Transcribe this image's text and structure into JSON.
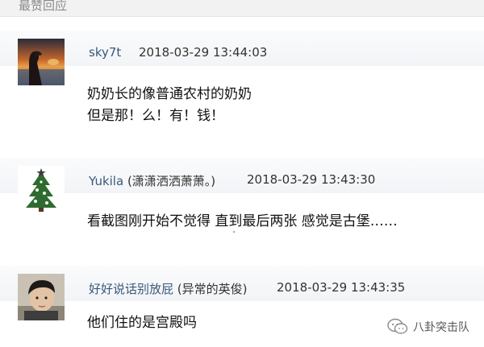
{
  "section": {
    "title": "最赞回应"
  },
  "comments": [
    {
      "username": "sky7t",
      "extra": "",
      "time": "2018-03-29 13:44:03",
      "lines": [
        "奶奶长的像普通农村的奶奶",
        "但是那！么！有！钱！"
      ],
      "avatar_icon": "sunset-photo-avatar"
    },
    {
      "username": "Yukila",
      "extra": "(潇潇洒洒萧萧。)",
      "time": "2018-03-29 13:43:30",
      "lines": [
        "看截图刚开始不觉得 直到最后两张 感觉是古堡……"
      ],
      "avatar_icon": "christmas-tree-avatar"
    },
    {
      "username": "好好说话别放屁",
      "extra": "(异常的英俊)",
      "time": "2018-03-29 13:43:35",
      "lines": [
        "他们住的是宫殿吗"
      ],
      "avatar_icon": "person-photo-avatar"
    }
  ],
  "watermark": {
    "text": "八卦突击队",
    "icon": "wechat-icon"
  },
  "colors": {
    "username": "#3a587a",
    "header_bg": "#f2f2f2",
    "title": "#8a8a8a"
  }
}
